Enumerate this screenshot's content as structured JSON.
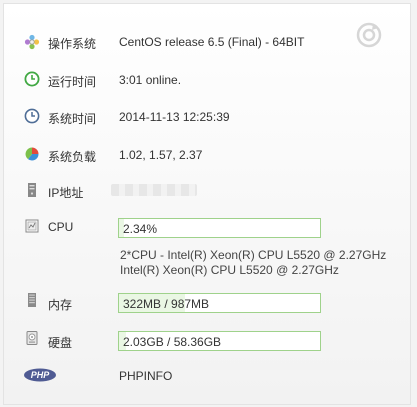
{
  "rows": {
    "os": {
      "label": "操作系统",
      "value": "CentOS release 6.5 (Final) - 64BIT",
      "icon": "gear-flower-icon"
    },
    "uptime": {
      "label": "运行时间",
      "value": "3:01 online.",
      "icon": "clock-green-icon"
    },
    "systime": {
      "label": "系统时间",
      "value": "2014-11-13 12:25:39",
      "icon": "clock-blue-icon"
    },
    "load": {
      "label": "系统负载",
      "value": "1.02, 1.57, 2.37",
      "icon": "pie-chart-icon"
    },
    "ip": {
      "label": "IP地址",
      "icon": "server-icon"
    },
    "cpu": {
      "label": "CPU",
      "usage_text": "2.34%",
      "usage_fraction": 0.0234,
      "info_line1": "2*CPU - Intel(R) Xeon(R) CPU L5520 @ 2.27GHz",
      "info_line2": "Intel(R) Xeon(R) CPU L5520 @ 2.27GHz",
      "icon": "cpu-icon"
    },
    "memory": {
      "label": "内存",
      "value": "322MB / 987MB",
      "usage_fraction": 0.326,
      "icon": "memory-icon"
    },
    "disk": {
      "label": "硬盘",
      "value": "2.03GB / 58.36GB",
      "usage_fraction": 0.035,
      "icon": "disk-icon"
    },
    "php": {
      "logo": "PHP",
      "link": "PHPINFO",
      "icon": "php-logo-icon"
    }
  },
  "colors": {
    "bar_border": "#9fd28b",
    "bar_fill": "#eaf7e4"
  }
}
